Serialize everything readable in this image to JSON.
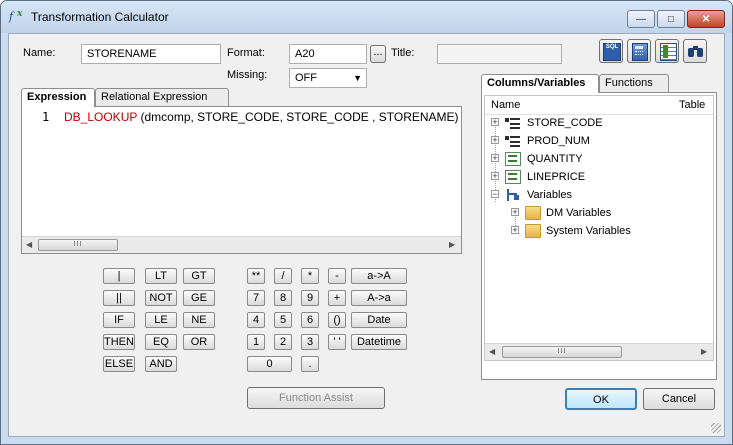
{
  "window": {
    "title": "Transformation Calculator",
    "controls": {
      "minimize": "—",
      "maximize": "□",
      "close": "✕"
    }
  },
  "form": {
    "name_label": "Name:",
    "name_value": "STORENAME",
    "format_label": "Format:",
    "format_value": "A20",
    "format_browse": "...",
    "title_label": "Title:",
    "title_value": "",
    "missing_label": "Missing:",
    "missing_value": "OFF"
  },
  "toolbar": [
    {
      "name": "sql-icon",
      "text": "SQL"
    },
    {
      "name": "calculator-icon",
      "text": ""
    },
    {
      "name": "grid-icon",
      "text": ""
    },
    {
      "name": "binoculars-icon",
      "text": ""
    }
  ],
  "editor": {
    "tabs": [
      "Expression",
      "Relational Expression"
    ],
    "active_tab": "Expression",
    "line_number": "1",
    "function_name": "DB_LOOKUP",
    "arguments": " (dmcomp, STORE_CODE, STORE_CODE , STORENAME)",
    "scroll_grip": "III",
    "scroll_left": "◀",
    "scroll_right": "▶"
  },
  "keypad": {
    "operators": [
      [
        "|",
        "LT",
        "GT"
      ],
      [
        "||",
        "NOT",
        "GE"
      ],
      [
        "IF",
        "LE",
        "NE"
      ],
      [
        "THEN",
        "EQ",
        "OR"
      ],
      [
        "ELSE",
        "AND"
      ]
    ],
    "numeric": [
      [
        "**",
        "/",
        "*",
        "-",
        "a->A"
      ],
      [
        "7",
        "8",
        "9",
        "+",
        "A->a"
      ],
      [
        "4",
        "5",
        "6",
        "()",
        "Date"
      ],
      [
        "1",
        "2",
        "3",
        "' '",
        "Datetime"
      ],
      [
        "0",
        "."
      ]
    ],
    "function_assist": "Function Assist"
  },
  "side_panel": {
    "tabs": [
      "Columns/Variables",
      "Functions"
    ],
    "active_tab": "Columns/Variables",
    "columns": [
      "Name",
      "Table"
    ],
    "tree": [
      {
        "label": "STORE_CODE",
        "icon": "dimension-icon"
      },
      {
        "label": "PROD_NUM",
        "icon": "dimension-icon"
      },
      {
        "label": "QUANTITY",
        "icon": "measure-icon"
      },
      {
        "label": "LINEPRICE",
        "icon": "measure-icon"
      },
      {
        "label": "Variables",
        "icon": "variables-icon"
      },
      {
        "label": "DM Variables",
        "icon": "folder-icon"
      },
      {
        "label": "System Variables",
        "icon": "folder-icon"
      }
    ],
    "scroll_grip": "III",
    "scroll_left": "◀",
    "scroll_right": "▶"
  },
  "footer": {
    "ok": "OK",
    "cancel": "Cancel"
  },
  "colors": {
    "function_name": "#c00000",
    "line_number": "#000000",
    "accent": "#3c7fb1"
  }
}
